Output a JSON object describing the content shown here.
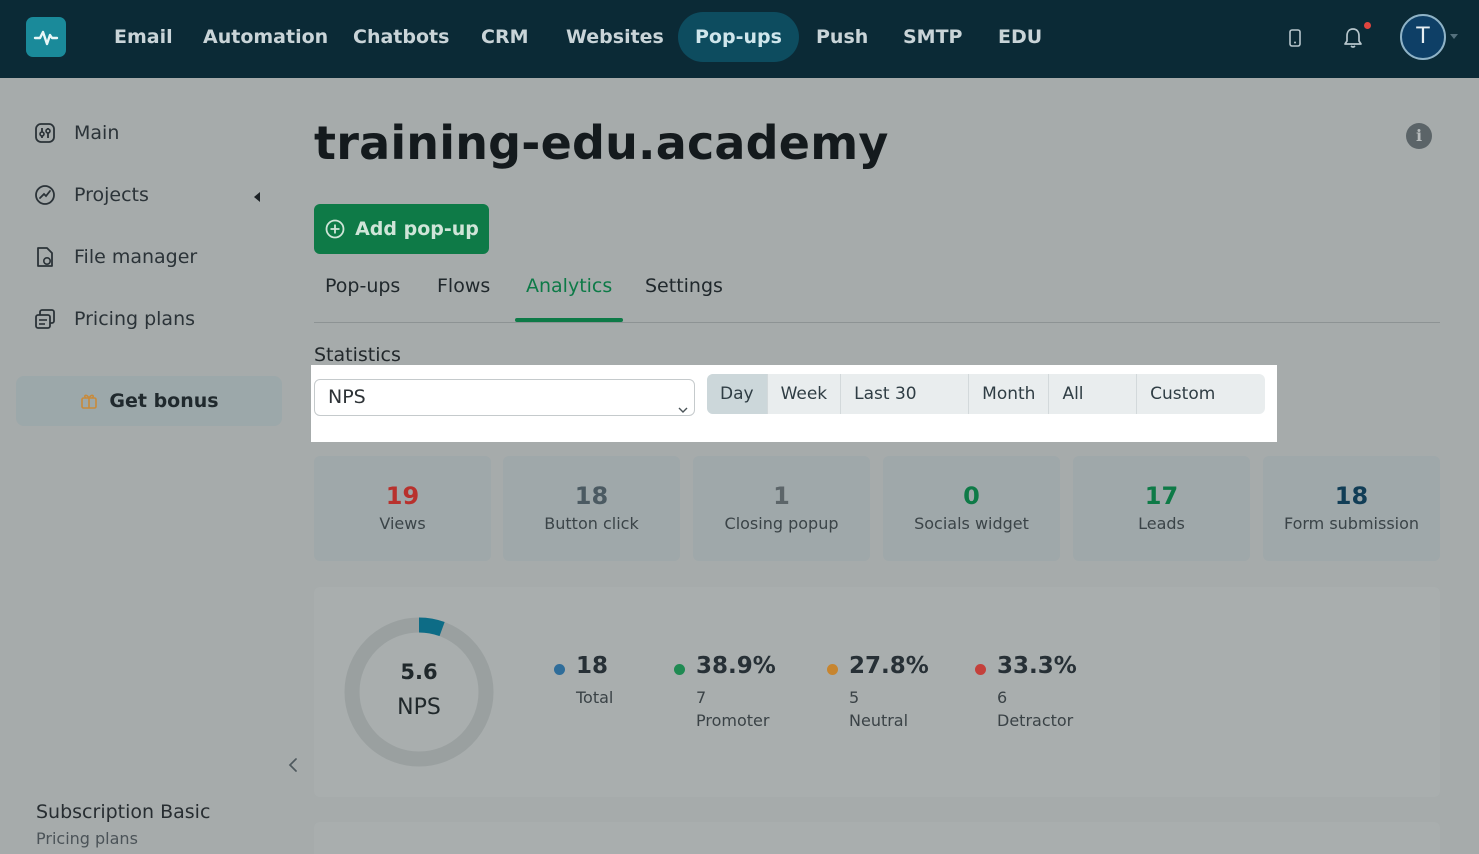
{
  "nav": {
    "items": [
      {
        "label": "Email"
      },
      {
        "label": "Automation"
      },
      {
        "label": "Chatbots"
      },
      {
        "label": "CRM"
      },
      {
        "label": "Websites"
      },
      {
        "label": "Pop-ups"
      },
      {
        "label": "Push"
      },
      {
        "label": "SMTP"
      },
      {
        "label": "EDU"
      }
    ],
    "active": "Pop-ups",
    "avatar_letter": "T"
  },
  "sidebar": {
    "items": [
      {
        "label": "Main",
        "icon": "dashboard-icon"
      },
      {
        "label": "Projects",
        "icon": "projects-icon"
      },
      {
        "label": "File manager",
        "icon": "file-manager-icon"
      },
      {
        "label": "Pricing plans",
        "icon": "pricing-icon"
      }
    ],
    "bonus_label": "Get bonus",
    "subscription_title": "Subscription Basic",
    "subscription_link": "Pricing plans"
  },
  "main": {
    "title": "training-edu.academy",
    "add_button": "Add pop-up",
    "tabs": [
      {
        "label": "Pop-ups"
      },
      {
        "label": "Flows"
      },
      {
        "label": "Analytics"
      },
      {
        "label": "Settings"
      }
    ],
    "active_tab": "Analytics",
    "statistics_label": "Statistics",
    "select_value": "NPS",
    "periods": [
      {
        "label": "Day"
      },
      {
        "label": "Week"
      },
      {
        "label": "Last 30 days"
      },
      {
        "label": "Month"
      },
      {
        "label": "All time"
      },
      {
        "label": "Custom date"
      }
    ],
    "active_period": "Day",
    "cards": [
      {
        "value": "19",
        "label": "Views",
        "color": "#b8312d"
      },
      {
        "value": "18",
        "label": "Button click",
        "color": "#4b5a62"
      },
      {
        "value": "1",
        "label": "Closing popup",
        "color": "#5c6569"
      },
      {
        "value": "0",
        "label": "Socials widget",
        "color": "#0e7a47"
      },
      {
        "value": "17",
        "label": "Leads",
        "color": "#0e7a47"
      },
      {
        "value": "18",
        "label": "Form submission",
        "color": "#113d56"
      }
    ],
    "nps": {
      "score": "5.6",
      "label": "NPS",
      "fill_fraction": 0.056,
      "ring_color": "#0d6c86",
      "legend": [
        {
          "big": "18",
          "sub1": "Total",
          "sub2": "",
          "color": "#2f6d9a"
        },
        {
          "big": "38.9%",
          "sub1": "7",
          "sub2": "Promoter",
          "color": "#1f8a52"
        },
        {
          "big": "27.8%",
          "sub1": "5",
          "sub2": "Neutral",
          "color": "#c7852f"
        },
        {
          "big": "33.3%",
          "sub1": "6",
          "sub2": "Detractor",
          "color": "#c4403b"
        }
      ]
    }
  }
}
